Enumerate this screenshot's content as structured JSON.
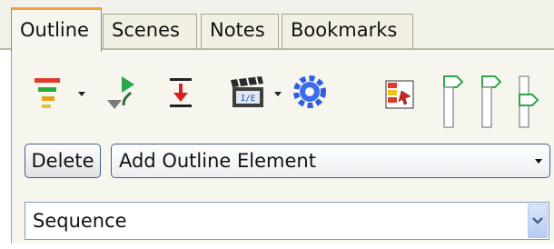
{
  "tabs": [
    {
      "label": "Outline"
    },
    {
      "label": "Scenes"
    },
    {
      "label": "Notes"
    },
    {
      "label": "Bookmarks"
    }
  ],
  "toolbar": {
    "icons": [
      "outline-levels-icon",
      "move-down-icon",
      "collapse-down-icon",
      "clapperboard-icon",
      "gear-icon",
      "element-picker-icon",
      "slider-marker-icon"
    ]
  },
  "delete_label": "Delete",
  "add_element": {
    "value": "Add Outline Element"
  },
  "element_type": {
    "value": "Sequence"
  },
  "colors": {
    "active_tab_accent": "#f1a33a",
    "button_border": "#3f5f8e",
    "combo_border": "#7f9db9"
  }
}
